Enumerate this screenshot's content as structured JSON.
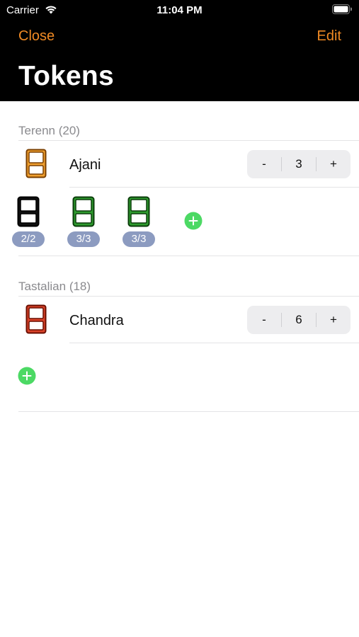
{
  "status_bar": {
    "carrier": "Carrier",
    "time": "11:04 PM"
  },
  "nav": {
    "close_label": "Close",
    "edit_label": "Edit",
    "title": "Tokens"
  },
  "colors": {
    "accent": "#f08a24",
    "add_green": "#4cd964",
    "badge": "#8c9bc0"
  },
  "sections": [
    {
      "header": "Terenn (20)",
      "player": {
        "name": "Ajani",
        "icon": "card-icon-orange",
        "count": "3"
      },
      "tokens": [
        {
          "icon": "card-icon-black",
          "pt": "2/2"
        },
        {
          "icon": "card-icon-green",
          "pt": "3/3"
        },
        {
          "icon": "card-icon-green",
          "pt": "3/3"
        }
      ]
    },
    {
      "header": "Tastalian (18)",
      "player": {
        "name": "Chandra",
        "icon": "card-icon-red",
        "count": "6"
      },
      "tokens": []
    }
  ],
  "stepper": {
    "minus": "-",
    "plus": "+"
  }
}
